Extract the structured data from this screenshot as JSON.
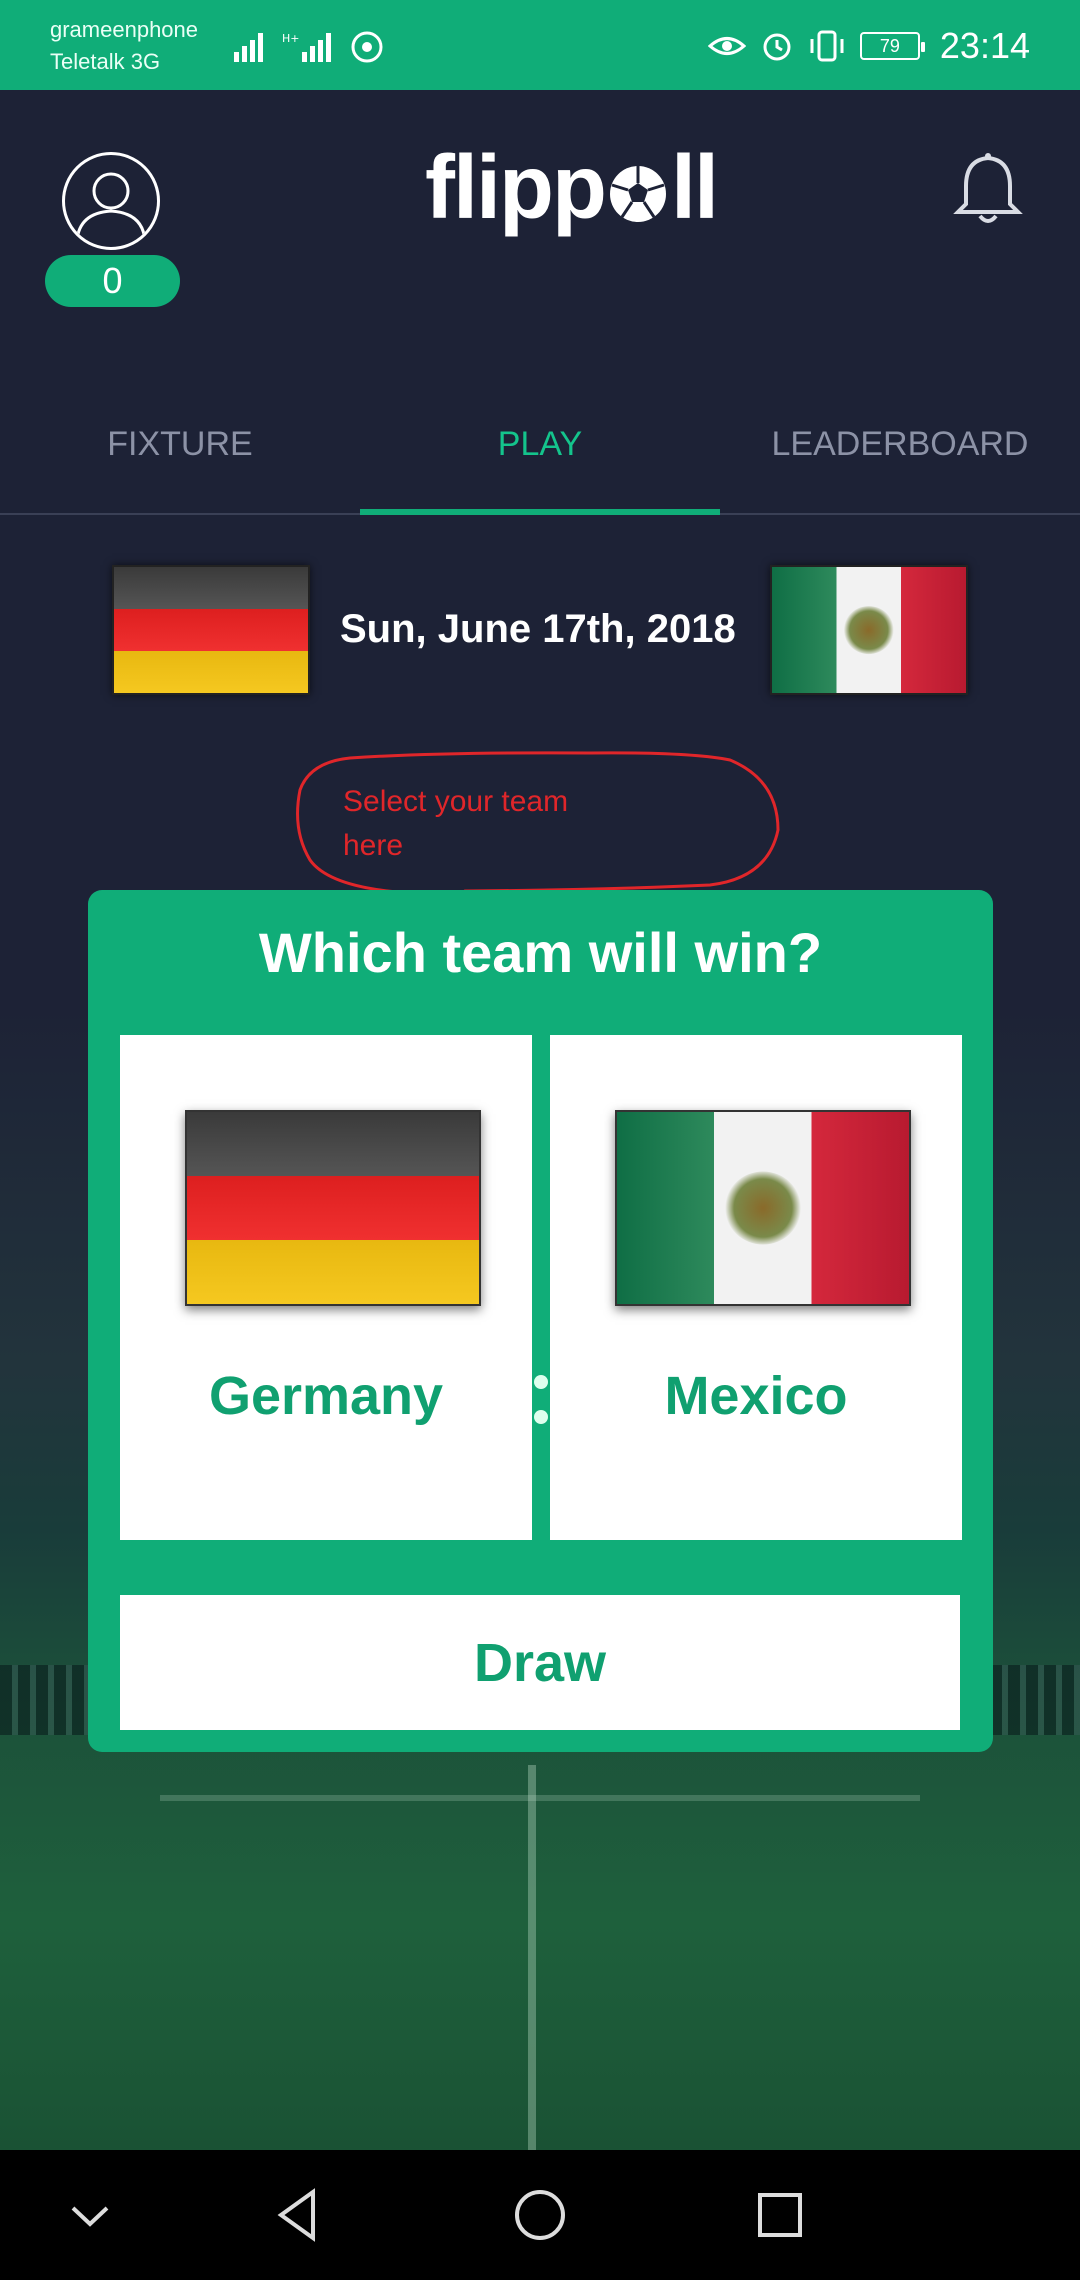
{
  "status_bar": {
    "carrier_1": "grameenphone",
    "carrier_2": "Teletalk 3G",
    "battery": "79",
    "time": "23:14"
  },
  "header": {
    "points": "0",
    "logo_text_1": "flipp",
    "logo_text_2": "ll"
  },
  "tabs": [
    {
      "label": "FIXTURE",
      "active": false
    },
    {
      "label": "PLAY",
      "active": true
    },
    {
      "label": "LEADERBOARD",
      "active": false
    }
  ],
  "match": {
    "date": "Sun, June 17th, 2018",
    "home": "Germany",
    "away": "Mexico"
  },
  "callout": {
    "text_line_1": "Select your team",
    "text_line_2": "here",
    "color": "#e0262a"
  },
  "prediction": {
    "question": "Which team will win?",
    "option_home": "Germany",
    "option_away": "Mexico",
    "draw_label": "Draw"
  },
  "colors": {
    "accent": "#10ad78",
    "background": "#1d2236",
    "text_green": "#10a070"
  },
  "icons": {
    "avatar": "user-outline-icon",
    "notifications": "bell-icon",
    "nav_back": "triangle-back-icon",
    "nav_home": "circle-home-icon",
    "nav_recents": "square-recents-icon",
    "nav_collapse": "chevron-down-icon"
  }
}
